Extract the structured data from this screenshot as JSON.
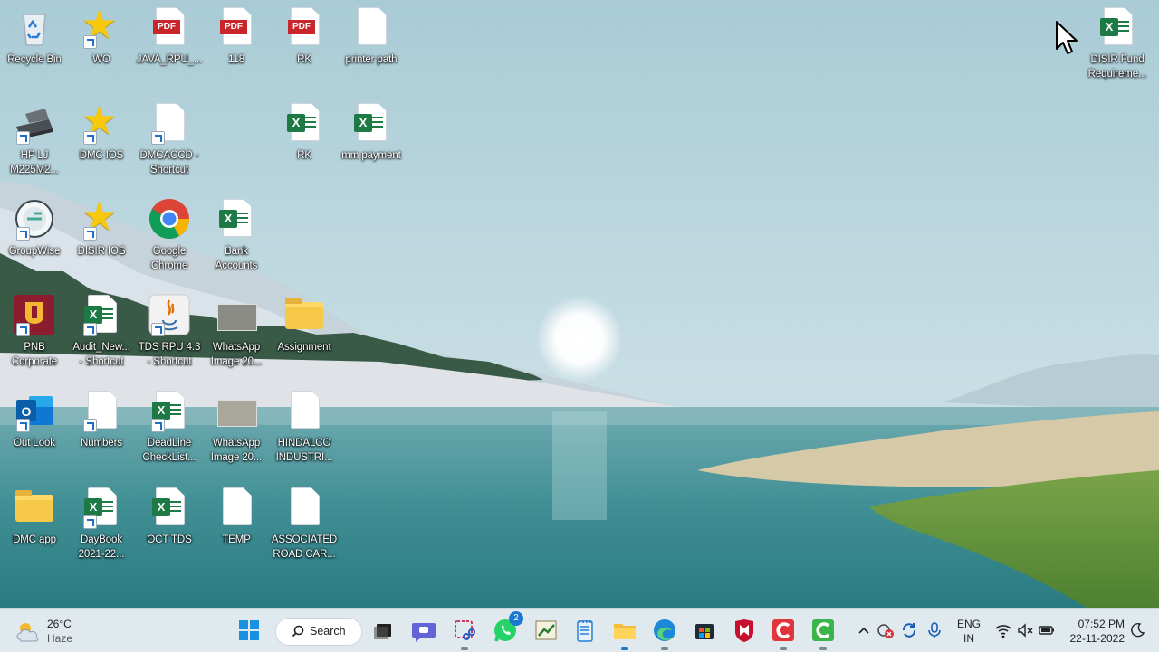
{
  "desktop": {
    "icons": [
      {
        "label": "Recycle Bin",
        "icon": "recycle-bin-icon"
      },
      {
        "label": "WO",
        "icon": "star-icon"
      },
      {
        "label": "JAVA_RPU_...",
        "icon": "pdf-file-icon"
      },
      {
        "label": "118",
        "icon": "pdf-file-icon"
      },
      {
        "label": "RK",
        "icon": "pdf-file-icon"
      },
      {
        "label": "printer path",
        "icon": "text-file-icon"
      },
      {
        "label": "HP LJ\nM225M2...",
        "icon": "scanner-icon"
      },
      {
        "label": "DMC IOS",
        "icon": "star-icon"
      },
      {
        "label": "DMCACCD -\nShortcut",
        "icon": "text-file-icon"
      },
      {
        "label": "RK",
        "icon": "excel-file-icon"
      },
      {
        "label": "mm payment",
        "icon": "excel-file-icon"
      },
      {
        "label": "GroupWise",
        "icon": "groupwise-icon"
      },
      {
        "label": "DISIR IOS",
        "icon": "star-icon"
      },
      {
        "label": "Google\nChrome",
        "icon": "chrome-icon"
      },
      {
        "label": "Bank\nAccounts",
        "icon": "excel-file-icon"
      },
      {
        "label": "PNB\nCorporate",
        "icon": "pnb-icon"
      },
      {
        "label": "Audit_New...\n- Shortcut",
        "icon": "excel-file-icon"
      },
      {
        "label": "TDS RPU 4.3\n- Shortcut",
        "icon": "java-icon"
      },
      {
        "label": "WhatsApp\nImage 20...",
        "icon": "image-thumbnail-icon"
      },
      {
        "label": "Assignment",
        "icon": "folder-icon"
      },
      {
        "label": "Out Look",
        "icon": "outlook-icon"
      },
      {
        "label": "Numbers",
        "icon": "text-file-icon"
      },
      {
        "label": "DeadLine\nCheckList...",
        "icon": "excel-file-icon"
      },
      {
        "label": "WhatsApp\nImage 20...",
        "icon": "image-thumbnail-icon"
      },
      {
        "label": "HINDALCO\nINDUSTRI...",
        "icon": "text-file-icon"
      },
      {
        "label": "DMC app",
        "icon": "folder-icon"
      },
      {
        "label": "DayBook\n2021-22...",
        "icon": "excel-file-icon"
      },
      {
        "label": "OCT TDS",
        "icon": "excel-file-icon"
      },
      {
        "label": "TEMP",
        "icon": "text-file-icon"
      },
      {
        "label": "ASSOCIATED\nROAD CAR...",
        "icon": "text-file-icon"
      },
      {
        "label": "DISIR Fund\nRequireme...",
        "icon": "excel-file-icon"
      }
    ],
    "pdf_badge": "PDF",
    "excel_badge": "X"
  },
  "taskbar": {
    "weather": {
      "temp": "26°C",
      "condition": "Haze",
      "icon": "weather-cloud-sun-icon"
    },
    "search_label": "Search",
    "whatsapp_badge": "2",
    "language": {
      "line1": "ENG",
      "line2": "IN"
    },
    "clock": {
      "time": "07:52 PM",
      "date": "22-11-2022"
    },
    "apps": [
      "start-icon",
      "search-icon",
      "task-view-icon",
      "teams-chat-icon",
      "snipping-tool-icon",
      "whatsapp-icon",
      "tally-icon",
      "notepad-icon",
      "file-explorer-icon",
      "edge-icon",
      "store-icon",
      "mcafee-icon",
      "app-red-icon",
      "app-green-icon"
    ]
  }
}
